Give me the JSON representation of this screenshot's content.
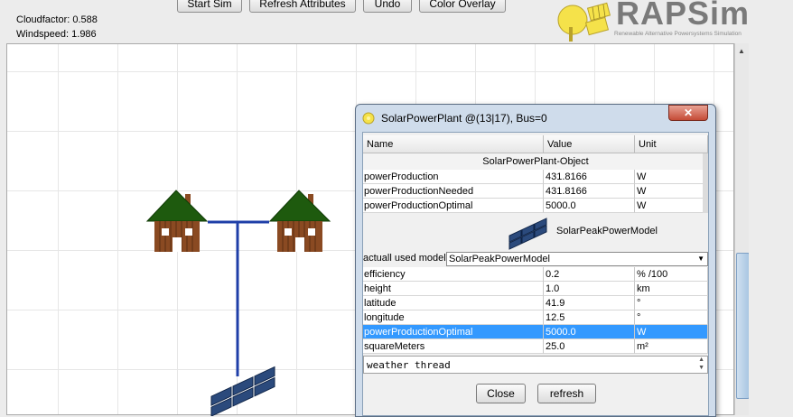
{
  "status": {
    "cloudfactor": "Cloudfactor: 0.588",
    "windspeed": "Windspeed: 1.986"
  },
  "toolbar": {
    "start_sim": "Start Sim",
    "refresh_attributes": "Refresh Attributes",
    "undo": "Undo",
    "color_overlay": "Color Overlay"
  },
  "logo": {
    "name": "RAPSim",
    "tagline": "Renewable Alternative Powersystems Simulation"
  },
  "dialog": {
    "title": "SolarPowerPlant @(13|17), Bus=0",
    "columns": [
      "Name",
      "Value",
      "Unit"
    ],
    "section_title": "SolarPowerPlant-Object",
    "rows_top": [
      {
        "name": "powerProduction",
        "value": "431.8166",
        "unit": "W"
      },
      {
        "name": "powerProductionNeeded",
        "value": "431.8166",
        "unit": "W"
      },
      {
        "name": "powerProductionOptimal",
        "value": "5000.0",
        "unit": "W"
      }
    ],
    "model_label": "SolarPeakPowerModel",
    "model_select_label": "actuall used model:",
    "model_select_value": "SolarPeakPowerModel",
    "rows_model": [
      {
        "name": "efficiency",
        "value": "0.2",
        "unit": "% /100"
      },
      {
        "name": "height",
        "value": "1.0",
        "unit": "km"
      },
      {
        "name": "latitude",
        "value": "41.9",
        "unit": "°"
      },
      {
        "name": "longitude",
        "value": "12.5",
        "unit": "°"
      },
      {
        "name": "powerProductionOptimal",
        "value": "5000.0",
        "unit": "W"
      },
      {
        "name": "squareMeters",
        "value": "25.0",
        "unit": "m²"
      }
    ],
    "thread_text": "weather thread",
    "close_button": "Close",
    "refresh_button": "refresh"
  },
  "colors": {
    "accent": "#3399ff",
    "wire": "#1f3fa8",
    "roof": "#1e5a0e",
    "wall": "#8a4a22"
  }
}
